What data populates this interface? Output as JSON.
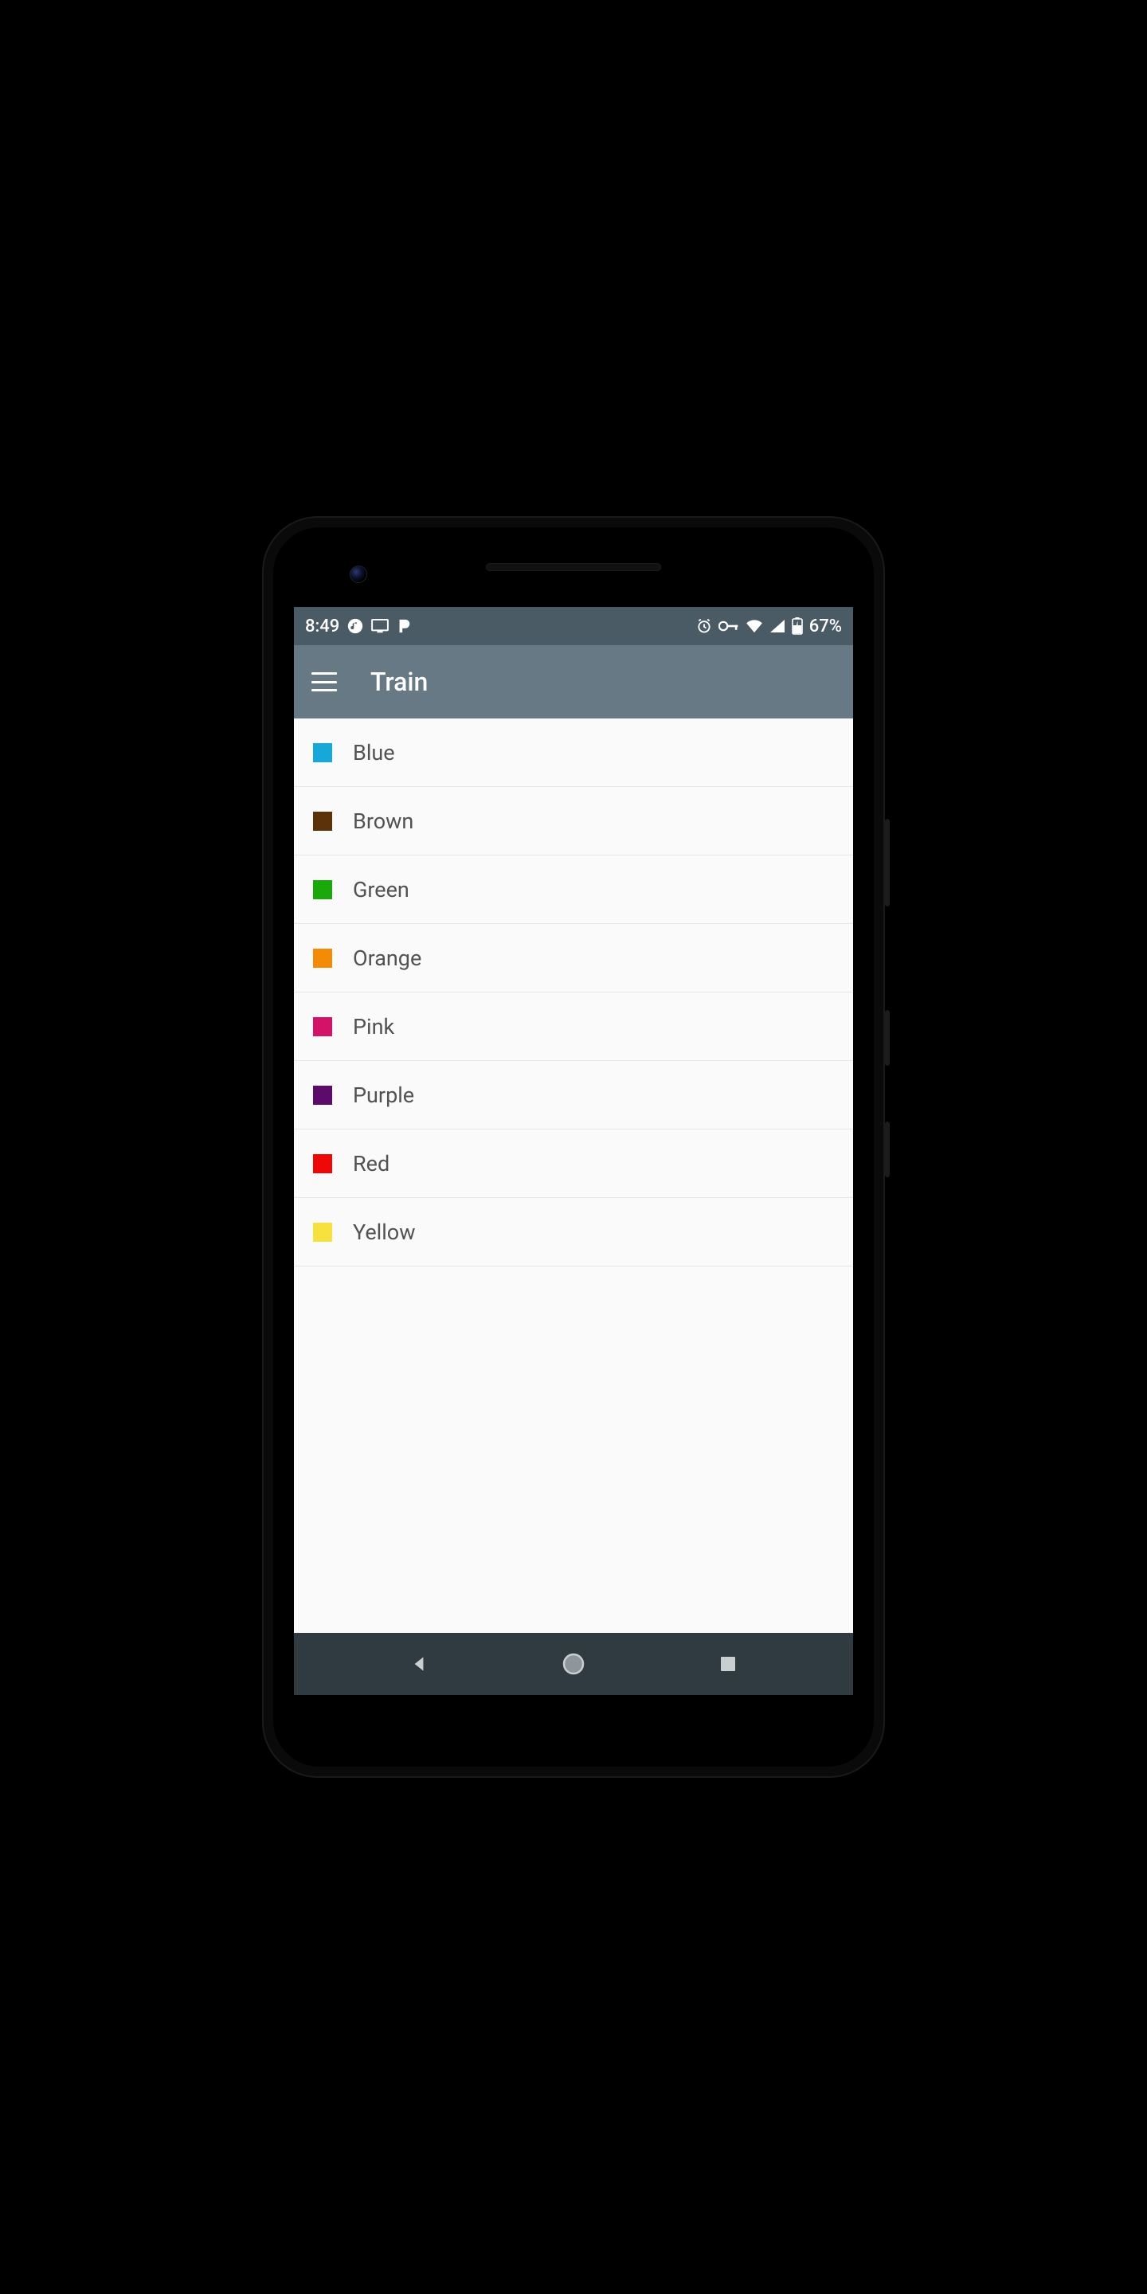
{
  "status": {
    "time": "8:49",
    "battery_text": "67%"
  },
  "appbar": {
    "title": "Train"
  },
  "list": {
    "items": [
      {
        "label": "Blue",
        "color": "#16a7db"
      },
      {
        "label": "Brown",
        "color": "#5b3209"
      },
      {
        "label": "Green",
        "color": "#1aa80a"
      },
      {
        "label": "Orange",
        "color": "#f38b06"
      },
      {
        "label": "Pink",
        "color": "#d41267"
      },
      {
        "label": "Purple",
        "color": "#5c0b6b"
      },
      {
        "label": "Red",
        "color": "#ef0808"
      },
      {
        "label": "Yellow",
        "color": "#f6e13f"
      }
    ]
  }
}
